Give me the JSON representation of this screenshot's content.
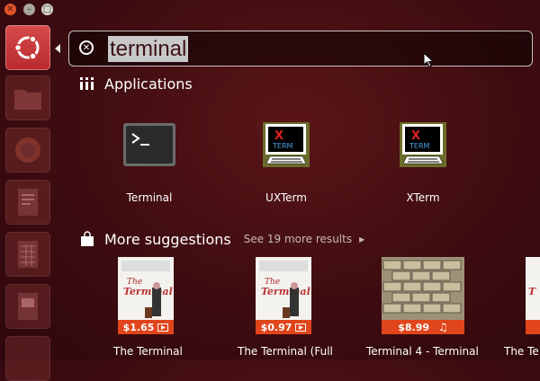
{
  "search": {
    "query": "terminal"
  },
  "sections": {
    "applications": {
      "title": "Applications",
      "apps": [
        {
          "name": "Terminal",
          "icon": "terminal-icon"
        },
        {
          "name": "UXTerm",
          "icon": "uxterm-icon"
        },
        {
          "name": "XTerm",
          "icon": "xterm-icon"
        }
      ]
    },
    "suggestions": {
      "title": "More suggestions",
      "more_link": "See 19 more results",
      "items": [
        {
          "label": "The Terminal",
          "price": "$1.65",
          "type": "video"
        },
        {
          "label": "The Terminal (Full",
          "price": "$0.97",
          "type": "video"
        },
        {
          "label": "Terminal 4 - Terminal",
          "price": "$8.99",
          "type": "music"
        },
        {
          "label": "The Te",
          "price": "",
          "type": "video"
        }
      ]
    }
  },
  "icons": {
    "xterm_x": "X",
    "xterm_term": "TERM"
  },
  "colors": {
    "dash_bg": "#3d0c10",
    "price_badge": "#e0451b",
    "query_highlight": "#c8c8c8"
  }
}
